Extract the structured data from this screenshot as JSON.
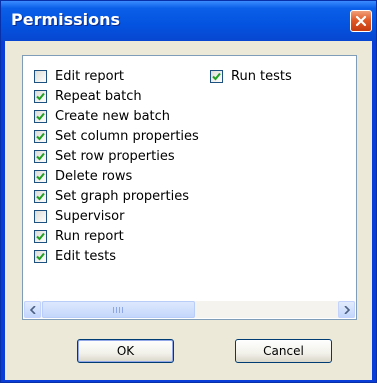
{
  "window": {
    "title": "Permissions"
  },
  "permissions": [
    {
      "label": "Edit report",
      "checked": false
    },
    {
      "label": "Repeat batch",
      "checked": true
    },
    {
      "label": "Create new batch",
      "checked": true
    },
    {
      "label": "Set column properties",
      "checked": true
    },
    {
      "label": "Set row properties",
      "checked": true
    },
    {
      "label": "Delete rows",
      "checked": true
    },
    {
      "label": "Set graph properties",
      "checked": true
    },
    {
      "label": "Supervisor",
      "checked": false
    },
    {
      "label": "Run report",
      "checked": true
    },
    {
      "label": "Edit tests",
      "checked": true
    },
    {
      "label": "Run tests",
      "checked": true
    }
  ],
  "buttons": {
    "ok": "OK",
    "cancel": "Cancel"
  },
  "colors": {
    "titlebar": "#0453e0",
    "client": "#ece9d8",
    "check": "#21a121",
    "close": "#e05a28"
  }
}
